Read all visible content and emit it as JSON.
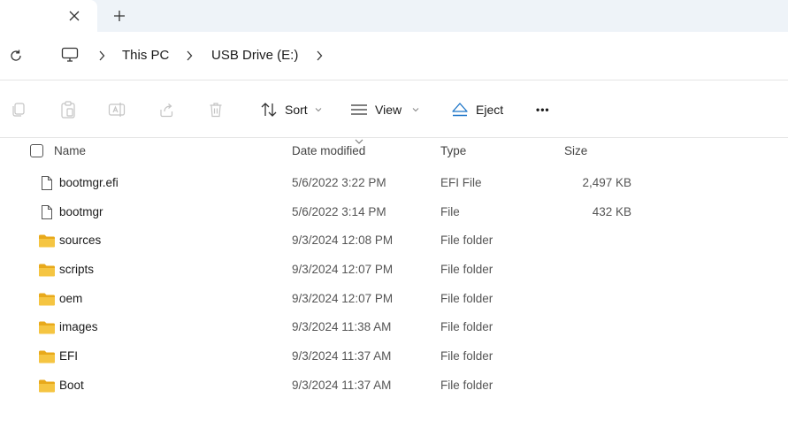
{
  "tabbar": {
    "close_glyph": "✕",
    "new_tab_glyph": "+"
  },
  "address": {
    "crumbs": [
      "This PC",
      "USB Drive (E:)"
    ]
  },
  "toolbar": {
    "sort_label": "Sort",
    "view_label": "View",
    "eject_label": "Eject",
    "more_glyph": "•••",
    "accent_color": "#1a73c7"
  },
  "columns": {
    "name": "Name",
    "date": "Date modified",
    "type": "Type",
    "size": "Size"
  },
  "files": [
    {
      "name": "bootmgr.efi",
      "date": "5/6/2022 3:22 PM",
      "type": "EFI File",
      "size": "2,497 KB",
      "icon": "file-icon"
    },
    {
      "name": "bootmgr",
      "date": "5/6/2022 3:14 PM",
      "type": "File",
      "size": "432 KB",
      "icon": "file-icon"
    },
    {
      "name": "sources",
      "date": "9/3/2024 12:08 PM",
      "type": "File folder",
      "size": "",
      "icon": "folder-icon"
    },
    {
      "name": "scripts",
      "date": "9/3/2024 12:07 PM",
      "type": "File folder",
      "size": "",
      "icon": "folder-icon"
    },
    {
      "name": "oem",
      "date": "9/3/2024 12:07 PM",
      "type": "File folder",
      "size": "",
      "icon": "folder-icon"
    },
    {
      "name": "images",
      "date": "9/3/2024 11:38 AM",
      "type": "File folder",
      "size": "",
      "icon": "folder-icon"
    },
    {
      "name": "EFI",
      "date": "9/3/2024 11:37 AM",
      "type": "File folder",
      "size": "",
      "icon": "folder-icon"
    },
    {
      "name": "Boot",
      "date": "9/3/2024 11:37 AM",
      "type": "File folder",
      "size": "",
      "icon": "folder-icon"
    }
  ],
  "colors": {
    "folder": "#f5c542",
    "folder_dark": "#e8a91b",
    "tabstrip_bg": "#eef3f8"
  }
}
